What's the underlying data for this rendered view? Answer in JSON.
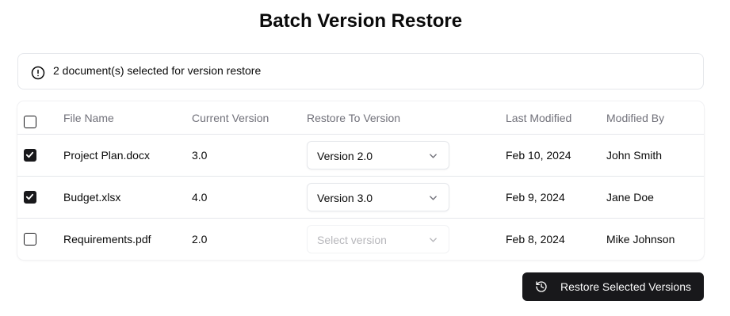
{
  "page": {
    "title": "Batch Version Restore"
  },
  "alert": {
    "icon": "alert-circle-icon",
    "text": "2 document(s) selected for version restore"
  },
  "table": {
    "headers": {
      "file_name": "File Name",
      "current_version": "Current Version",
      "restore_to": "Restore To Version",
      "last_modified": "Last Modified",
      "modified_by": "Modified By"
    },
    "select_all_checked": false,
    "rows": [
      {
        "checked": true,
        "file_name": "Project Plan.docx",
        "current_version": "3.0",
        "restore_to": "Version 2.0",
        "restore_enabled": true,
        "last_modified": "Feb 10, 2024",
        "modified_by": "John Smith"
      },
      {
        "checked": true,
        "file_name": "Budget.xlsx",
        "current_version": "4.0",
        "restore_to": "Version 3.0",
        "restore_enabled": true,
        "last_modified": "Feb 9, 2024",
        "modified_by": "Jane Doe"
      },
      {
        "checked": false,
        "file_name": "Requirements.pdf",
        "current_version": "2.0",
        "restore_to": "Select version",
        "restore_enabled": false,
        "last_modified": "Feb 8, 2024",
        "modified_by": "Mike Johnson"
      }
    ]
  },
  "actions": {
    "restore_label": "Restore Selected Versions",
    "restore_icon": "history-icon"
  },
  "colors": {
    "primary": "#18181b",
    "muted_text": "#71717a",
    "border": "#e5e7eb"
  }
}
